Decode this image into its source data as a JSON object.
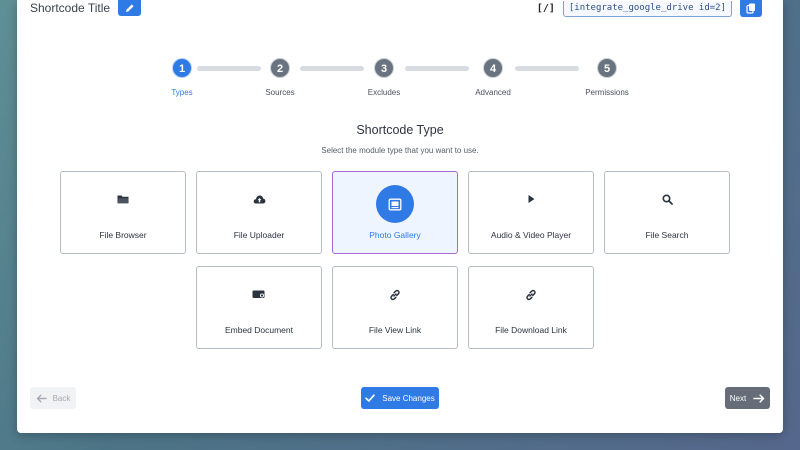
{
  "header": {
    "title": "Shortcode Title",
    "edit_icon": "pencil-icon",
    "shortcode_bracket": "[/]",
    "shortcode_value": "[integrate_google_drive id=2]",
    "copy_icon": "copy-icon"
  },
  "stepper": {
    "active_step": 1,
    "steps": [
      {
        "number": "1",
        "label": "Types"
      },
      {
        "number": "2",
        "label": "Sources"
      },
      {
        "number": "3",
        "label": "Excludes"
      },
      {
        "number": "4",
        "label": "Advanced"
      },
      {
        "number": "5",
        "label": "Permissions"
      }
    ]
  },
  "main": {
    "title": "Shortcode Type",
    "subtitle": "Select the module type that you want to use.",
    "selected_type": "Photo Gallery",
    "types": [
      {
        "label": "File Browser",
        "icon": "folder-icon"
      },
      {
        "label": "File Uploader",
        "icon": "cloud-upload-icon"
      },
      {
        "label": "Photo Gallery",
        "icon": "image-icon"
      },
      {
        "label": "Audio & Video Player",
        "icon": "play-icon"
      },
      {
        "label": "File Search",
        "icon": "search-icon"
      },
      {
        "label": "Embed Document",
        "icon": "embed-document-icon"
      },
      {
        "label": "File View Link",
        "icon": "link-icon"
      },
      {
        "label": "File Download Link",
        "icon": "link-icon"
      }
    ]
  },
  "footer": {
    "back_label": "Back",
    "save_label": "Save Changes",
    "next_label": "Next"
  },
  "colors": {
    "accent": "#2f7ae5",
    "selected_border": "#a56bd6",
    "inactive_step": "#6a7380"
  }
}
